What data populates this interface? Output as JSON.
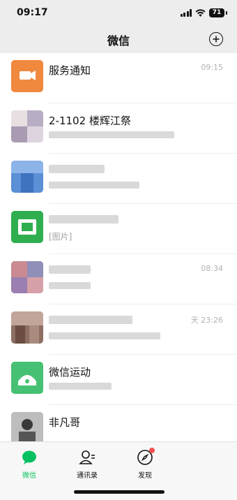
{
  "status_bar": {
    "time": "09:17",
    "battery": "71"
  },
  "header": {
    "title": "微信",
    "add_icon": "plus-circle-icon"
  },
  "chats": [
    {
      "name": "服务通知",
      "preview": "",
      "time": "09:15",
      "avatar_color": "#f0883e"
    },
    {
      "name": "2-1102 楼辉江祭",
      "preview": "",
      "time": "",
      "avatar_color": "#c9c2d6"
    },
    {
      "name": "",
      "preview": "",
      "time": "",
      "avatar_color": "#5b8fd6"
    },
    {
      "name": "",
      "preview": "[图片]",
      "time": "",
      "avatar_color": "#2fae4f"
    },
    {
      "name": "",
      "preview": "",
      "time": "08:34",
      "avatar_color": "#b76f7e"
    },
    {
      "name": "",
      "preview": "",
      "time": "天 23:26",
      "avatar_color": "#8e6e62"
    },
    {
      "name": "微信运动",
      "preview": "",
      "time": "",
      "avatar_color": "#46c173"
    },
    {
      "name": "非凡哥",
      "preview": "",
      "time": "",
      "avatar_color": "#8a8a8a"
    },
    {
      "name": "",
      "preview": "",
      "time": "",
      "avatar_color": "#d9b59a"
    }
  ],
  "tabs": [
    {
      "label": "微信",
      "icon": "chat-bubble-icon",
      "active": true
    },
    {
      "label": "通讯录",
      "icon": "contacts-icon",
      "active": false
    },
    {
      "label": "发现",
      "icon": "compass-icon",
      "active": false
    }
  ],
  "colors": {
    "accent": "#07c160",
    "badge": "#fa5151"
  }
}
